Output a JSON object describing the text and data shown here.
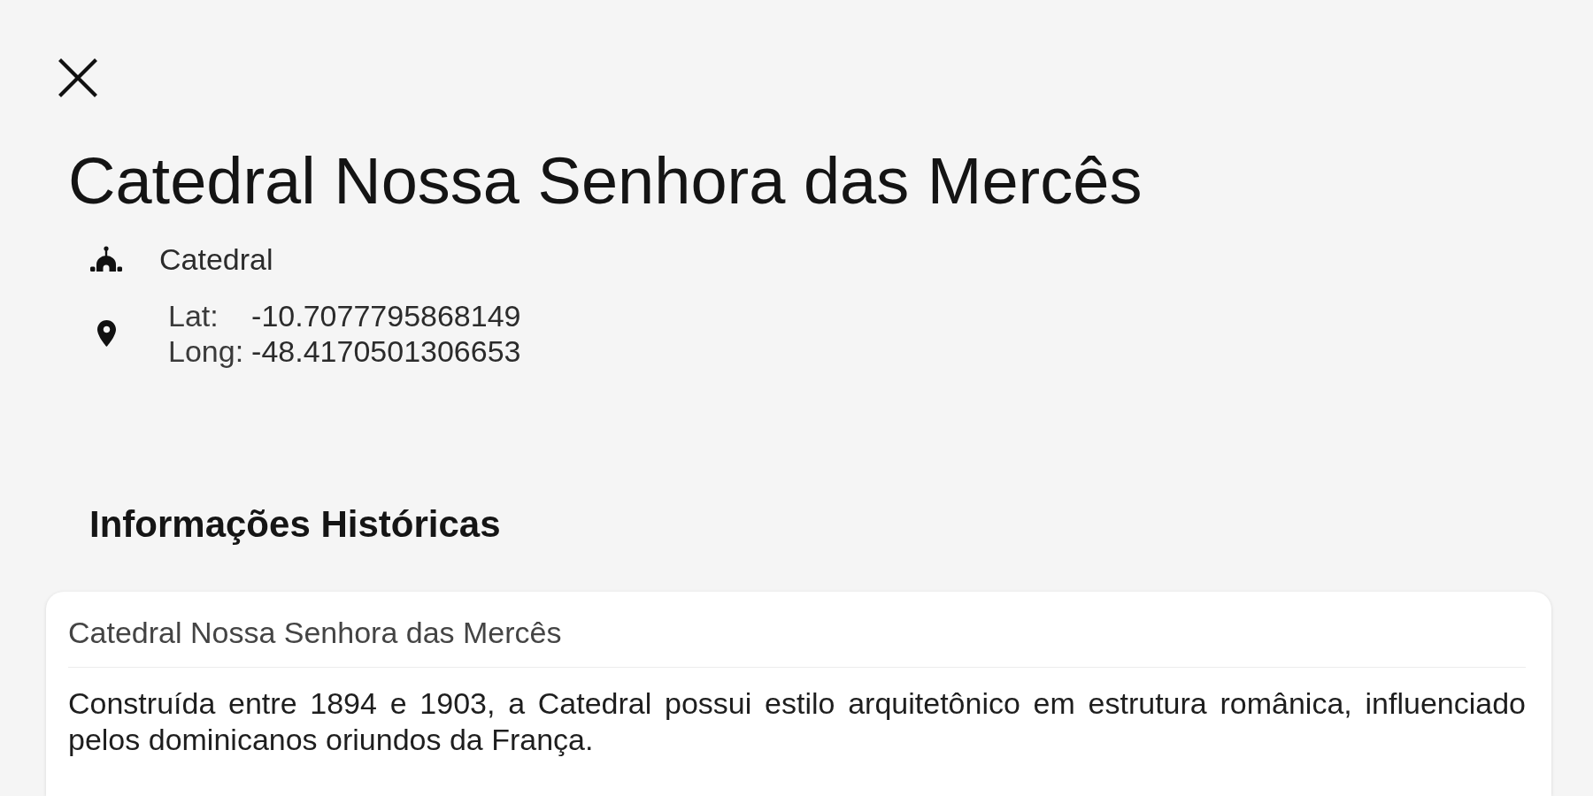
{
  "place": {
    "title": "Catedral Nossa Senhora das Mercês",
    "category": "Catedral",
    "coordinates": [
      {
        "label": "Lat:",
        "value": "-10.7077795868149"
      },
      {
        "label": "Long:",
        "value": "-48.4170501306653"
      }
    ]
  },
  "section": {
    "heading": "Informações Históricas",
    "card": {
      "title": "Catedral Nossa Senhora das Mercês",
      "text": "Construída entre 1894 e 1903, a Catedral possui estilo arquitetônico em estrutura românica, influenciado pelos dominicanos oriundos da França."
    }
  }
}
